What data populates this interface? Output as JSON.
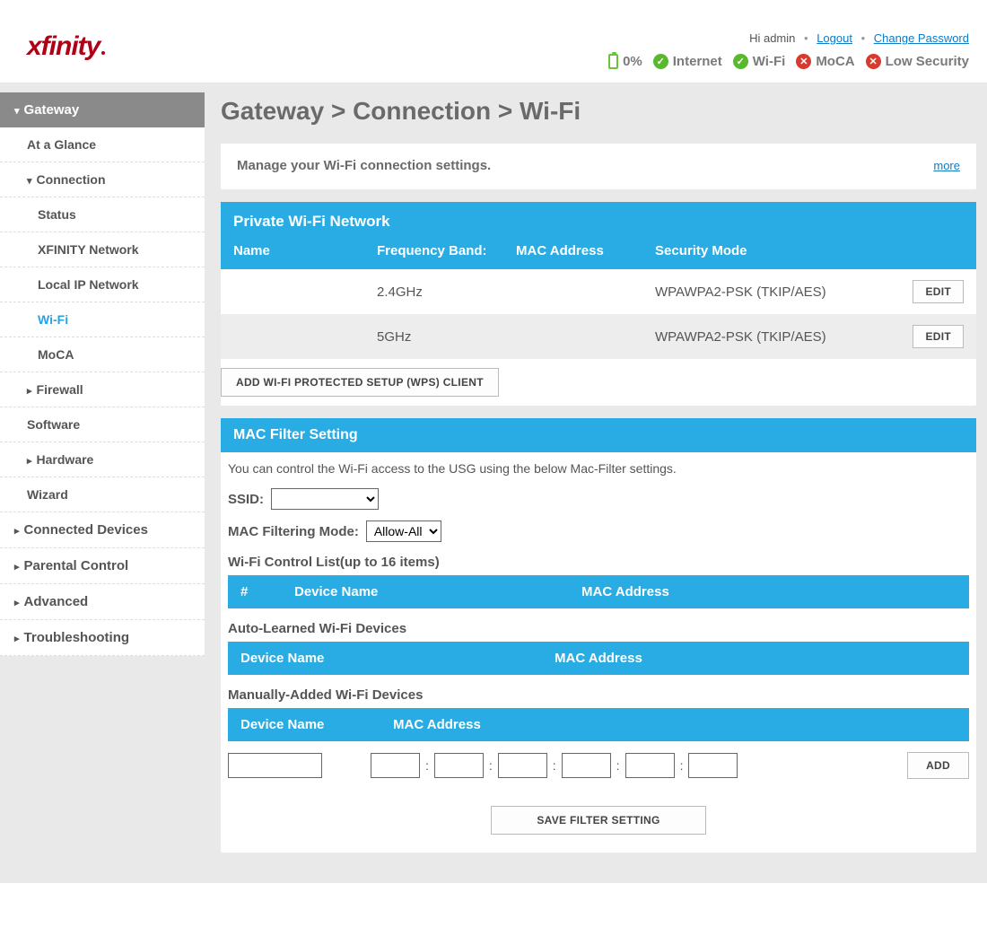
{
  "header": {
    "logo": "xfinity",
    "greeting": "Hi admin",
    "logout": "Logout",
    "change_password": "Change Password",
    "battery_pct": "0%",
    "status": {
      "internet": "Internet",
      "wifi": "Wi-Fi",
      "moca": "MoCA",
      "security": "Low Security"
    }
  },
  "sidebar": {
    "gateway": "Gateway",
    "at_a_glance": "At a Glance",
    "connection": "Connection",
    "status": "Status",
    "xfinity_network": "XFINITY Network",
    "local_ip": "Local IP Network",
    "wifi": "Wi-Fi",
    "moca": "MoCA",
    "firewall": "Firewall",
    "software": "Software",
    "hardware": "Hardware",
    "wizard": "Wizard",
    "connected": "Connected Devices",
    "parental": "Parental Control",
    "advanced": "Advanced",
    "troubleshooting": "Troubleshooting"
  },
  "breadcrumb": "Gateway > Connection > Wi-Fi",
  "desc": {
    "text": "Manage your Wi-Fi connection settings.",
    "more": "more"
  },
  "private_wifi": {
    "title": "Private Wi-Fi Network",
    "cols": {
      "name": "Name",
      "freq": "Frequency Band:",
      "mac": "MAC Address",
      "sec": "Security Mode"
    },
    "rows": [
      {
        "name": "",
        "freq": "2.4GHz",
        "mac": "",
        "sec": "WPAWPA2-PSK (TKIP/AES)",
        "edit": "EDIT"
      },
      {
        "name": "",
        "freq": "5GHz",
        "mac": "",
        "sec": "WPAWPA2-PSK (TKIP/AES)",
        "edit": "EDIT"
      }
    ],
    "wps_button": "ADD WI-FI PROTECTED SETUP (WPS) CLIENT"
  },
  "mac_filter": {
    "title": "MAC Filter Setting",
    "desc": "You can control the Wi-Fi access to the USG using the below Mac-Filter settings.",
    "ssid_label": "SSID:",
    "mode_label": "MAC Filtering Mode:",
    "mode_value": "Allow-All",
    "control_list_label": "Wi-Fi Control List(up to 16 items)",
    "control_cols": {
      "num": "#",
      "device": "Device Name",
      "mac": "MAC Address"
    },
    "auto_label": "Auto-Learned Wi-Fi Devices",
    "auto_cols": {
      "device": "Device Name",
      "mac": "MAC Address"
    },
    "manual_label": "Manually-Added Wi-Fi Devices",
    "manual_cols": {
      "device": "Device Name",
      "mac": "MAC Address"
    },
    "add_button": "ADD",
    "save_button": "SAVE FILTER SETTING"
  }
}
